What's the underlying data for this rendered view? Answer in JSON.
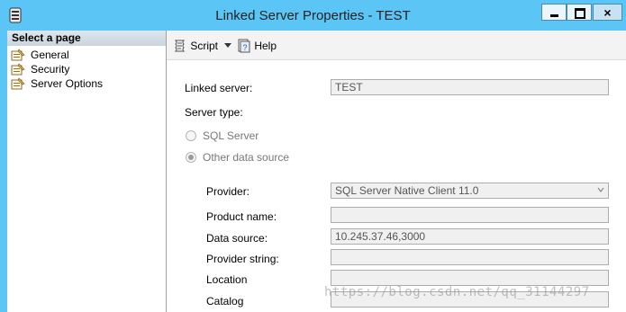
{
  "window": {
    "title": "Linked Server Properties - TEST",
    "close_glyph": "×"
  },
  "sidebar": {
    "header": "Select a page",
    "items": [
      {
        "label": "General",
        "icon": "page-wrench-icon"
      },
      {
        "label": "Security",
        "icon": "page-wrench-icon"
      },
      {
        "label": "Server Options",
        "icon": "page-wrench-icon"
      }
    ]
  },
  "toolbar": {
    "script_label": "Script",
    "help_label": "Help"
  },
  "form": {
    "linked_server_label": "Linked server:",
    "linked_server_value": "TEST",
    "server_type_label": "Server type:",
    "radio_sql_server": "SQL Server",
    "radio_other": "Other data source",
    "selected_server_type": "Other data source",
    "provider_label": "Provider:",
    "provider_value": "SQL Server Native Client 11.0",
    "product_name_label": "Product name:",
    "product_name_value": "",
    "data_source_label": "Data source:",
    "data_source_value": "10.245.37.46,3000",
    "provider_string_label": "Provider string:",
    "provider_string_value": "",
    "location_label": "Location",
    "location_value": "",
    "catalog_label": "Catalog",
    "catalog_value": ""
  },
  "watermark": "https://blog.csdn.net/qq_31144297"
}
